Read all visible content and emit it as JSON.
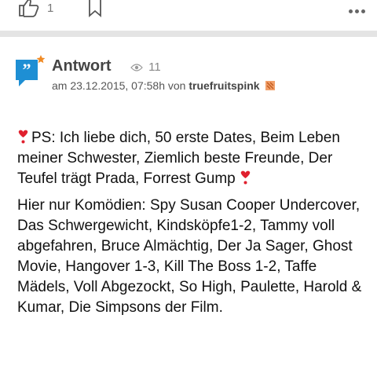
{
  "toolbar": {
    "like_count": "1",
    "icons": {
      "like": "thumbs-up-icon",
      "bookmark": "bookmark-icon",
      "more": "more-dots-icon"
    }
  },
  "answer": {
    "title": "Antwort",
    "views": "11",
    "meta_prefix": "am 23.12.2015, 07:58h von",
    "username": "truefruitspink",
    "accent_color": "#1e8fd4",
    "star_color": "#f08a24",
    "paragraphs": [
      {
        "before": "PS: Ich liebe dich, 50 erste Dates, Beim Leben meiner Schwester, Ziemlich beste Freunde, Der Teufel trägt Prada, Forrest Gump",
        "icon": "heart-exclamation-icon"
      },
      {
        "text": "Hier nur Komödien: Spy Susan Cooper Undercover, Das Schwergewicht, Kindsköpfe1-2, Tammy voll abgefahren, Bruce Almächtig, Der Ja Sager, Ghost Movie, Hangover 1-3, Kill The Boss 1-2, Taffe Mädels, Voll Abgezockt, So High, Paulette, Harold & Kumar, Die Simpsons der Film."
      }
    ]
  }
}
